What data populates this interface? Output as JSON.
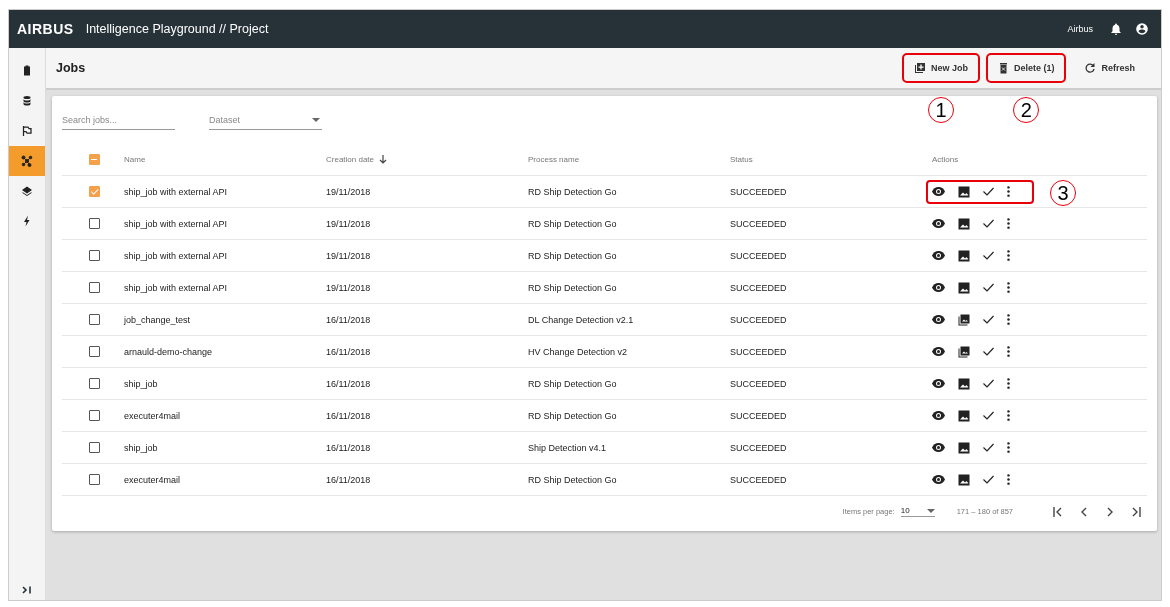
{
  "topbar": {
    "logo": "AIRBUS",
    "title": "Intelligence Playground // Project",
    "user": "Airbus"
  },
  "sidebar": {
    "items": [
      {
        "selected": false
      },
      {
        "selected": false
      },
      {
        "selected": false
      },
      {
        "selected": true
      },
      {
        "selected": false
      },
      {
        "selected": false
      }
    ]
  },
  "header": {
    "title": "Jobs",
    "buttons": [
      {
        "kind": "new",
        "label": "New Job",
        "highlighted": true,
        "callout": "1"
      },
      {
        "kind": "delete",
        "label": "Delete (1)",
        "highlighted": true,
        "callout": "2"
      },
      {
        "kind": "refresh",
        "label": "Refresh",
        "highlighted": false
      }
    ]
  },
  "filters": {
    "search": {
      "placeholder": "Search jobs..."
    },
    "dataset": {
      "placeholder": "Dataset"
    }
  },
  "table": {
    "select_all_checked": true,
    "select_all_partial": true,
    "columns": [
      {
        "label": "Name",
        "sorted": false
      },
      {
        "label": "Creation date",
        "sorted": true
      },
      {
        "label": "Process name",
        "sorted": false
      },
      {
        "label": "Status",
        "sorted": false
      },
      {
        "label": "Actions",
        "sorted": false
      }
    ],
    "rows": [
      {
        "name": "ship_job with external API",
        "date": "19/11/2018",
        "process": "RD Ship Detection Go",
        "status": "SUCCEEDED",
        "checked": true,
        "multiple_results": false,
        "actions_highlighted": true,
        "callout": "3"
      },
      {
        "name": "ship_job with external API",
        "date": "19/11/2018",
        "process": "RD Ship Detection Go",
        "status": "SUCCEEDED",
        "checked": false,
        "multiple_results": false,
        "actions_highlighted": false
      },
      {
        "name": "ship_job with external API",
        "date": "19/11/2018",
        "process": "RD Ship Detection Go",
        "status": "SUCCEEDED",
        "checked": false,
        "multiple_results": false,
        "actions_highlighted": false
      },
      {
        "name": "ship_job with external API",
        "date": "19/11/2018",
        "process": "RD Ship Detection Go",
        "status": "SUCCEEDED",
        "checked": false,
        "multiple_results": false,
        "actions_highlighted": false
      },
      {
        "name": "job_change_test",
        "date": "16/11/2018",
        "process": "DL Change Detection v2.1",
        "status": "SUCCEEDED",
        "checked": false,
        "multiple_results": true,
        "actions_highlighted": false
      },
      {
        "name": "arnauld-demo-change",
        "date": "16/11/2018",
        "process": "HV Change Detection v2",
        "status": "SUCCEEDED",
        "checked": false,
        "multiple_results": true,
        "actions_highlighted": false
      },
      {
        "name": "ship_job",
        "date": "16/11/2018",
        "process": "RD Ship Detection Go",
        "status": "SUCCEEDED",
        "checked": false,
        "multiple_results": false,
        "actions_highlighted": false
      },
      {
        "name": "executer4mail",
        "date": "16/11/2018",
        "process": "RD Ship Detection Go",
        "status": "SUCCEEDED",
        "checked": false,
        "multiple_results": false,
        "actions_highlighted": false
      },
      {
        "name": "ship_job",
        "date": "16/11/2018",
        "process": "Ship Detection v4.1",
        "status": "SUCCEEDED",
        "checked": false,
        "multiple_results": false,
        "actions_highlighted": false
      },
      {
        "name": "executer4mail",
        "date": "16/11/2018",
        "process": "RD Ship Detection Go",
        "status": "SUCCEEDED",
        "checked": false,
        "multiple_results": false,
        "actions_highlighted": false
      }
    ]
  },
  "paginator": {
    "label": "Items per page:",
    "page_size": "10",
    "range": "171 – 180 of 857"
  }
}
